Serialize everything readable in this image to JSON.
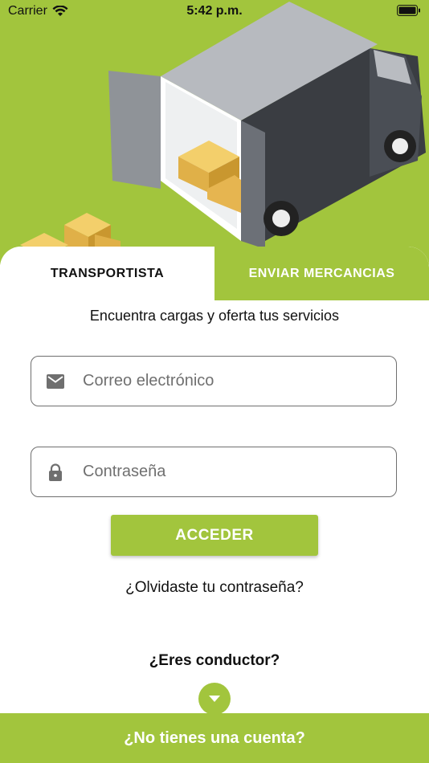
{
  "status_bar": {
    "carrier": "Carrier",
    "time": "5:42 p.m."
  },
  "tabs": {
    "transportista": "TRANSPORTISTA",
    "enviar": "ENVIAR MERCANCIAS"
  },
  "subtitle": "Encuentra cargas y oferta tus servicios",
  "email": {
    "placeholder": "Correo electrónico",
    "icon": "mail-icon"
  },
  "password": {
    "placeholder": "Contraseña",
    "icon": "lock-icon"
  },
  "login_button": "ACCEDER",
  "forgot_password": "¿Olvidaste tu contraseña?",
  "driver_prompt": "¿Eres conductor?",
  "signup": "¿No tienes una cuenta?",
  "colors": {
    "accent": "#a2c53d",
    "text": "#111111",
    "border": "#6f6f6f"
  }
}
